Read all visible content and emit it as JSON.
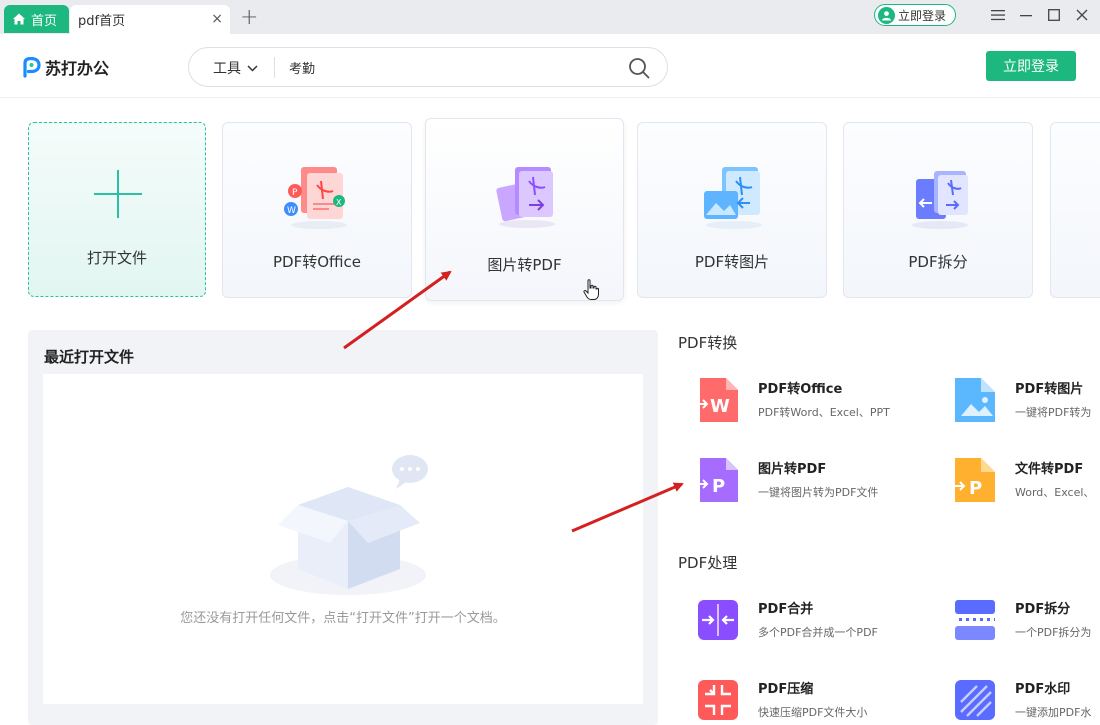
{
  "tabs": {
    "home_label": "首页",
    "current_label": "pdf首页",
    "close_symbol": "×",
    "add_symbol": "+"
  },
  "titlebar": {
    "login_label": "立即登录"
  },
  "header": {
    "logo_text": "苏打办公",
    "search": {
      "tools_label": "工具",
      "value": "考勤"
    },
    "login_button": "立即登录"
  },
  "cards": [
    {
      "label": "打开文件",
      "icon": "plus-icon"
    },
    {
      "label": "PDF转Office",
      "icon": "pdf-to-office-icon"
    },
    {
      "label": "图片转PDF",
      "icon": "image-to-pdf-icon"
    },
    {
      "label": "PDF转图片",
      "icon": "pdf-to-image-icon"
    },
    {
      "label": "PDF拆分",
      "icon": "pdf-split-icon"
    }
  ],
  "recent": {
    "title": "最近打开文件",
    "empty_text": "您还没有打开任何文件，点击“打开文件”打开一个文档。"
  },
  "sections": {
    "convert": {
      "title": "PDF转换",
      "items": [
        {
          "title": "PDF转Office",
          "desc": "PDF转Word、Excel、PPT",
          "icon": "pdf-to-word-icon"
        },
        {
          "title": "PDF转图片",
          "desc": "一键将PDF转为",
          "icon": "pdf-to-image-icon"
        },
        {
          "title": "图片转PDF",
          "desc": "一键将图片转为PDF文件",
          "icon": "image-to-pdf-icon"
        },
        {
          "title": "文件转PDF",
          "desc": "Word、Excel、",
          "icon": "file-to-pdf-icon"
        }
      ]
    },
    "process": {
      "title": "PDF处理",
      "items": [
        {
          "title": "PDF合并",
          "desc": "多个PDF合并成一个PDF",
          "icon": "pdf-merge-icon"
        },
        {
          "title": "PDF拆分",
          "desc": "一个PDF拆分为",
          "icon": "pdf-split-icon"
        },
        {
          "title": "PDF压缩",
          "desc": "快速压缩PDF文件大小",
          "icon": "pdf-compress-icon"
        },
        {
          "title": "PDF水印",
          "desc": "一键添加PDF水",
          "icon": "pdf-watermark-icon"
        }
      ]
    }
  },
  "colors": {
    "brand_green": "#1cb87f",
    "accent_teal": "#2bbfa4",
    "annotation_red": "#d42020"
  }
}
